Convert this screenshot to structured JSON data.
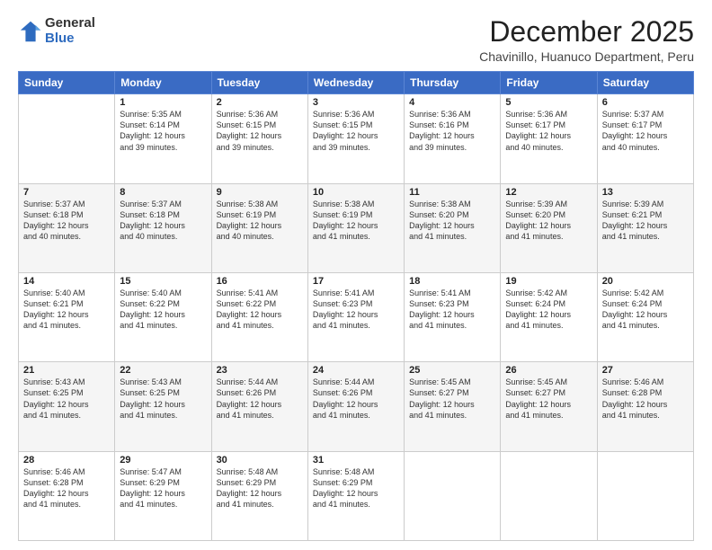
{
  "header": {
    "logo_line1": "General",
    "logo_line2": "Blue",
    "month": "December 2025",
    "location": "Chavinillo, Huanuco Department, Peru"
  },
  "days_of_week": [
    "Sunday",
    "Monday",
    "Tuesday",
    "Wednesday",
    "Thursday",
    "Friday",
    "Saturday"
  ],
  "weeks": [
    [
      {
        "day": "",
        "info": ""
      },
      {
        "day": "1",
        "info": "Sunrise: 5:35 AM\nSunset: 6:14 PM\nDaylight: 12 hours\nand 39 minutes."
      },
      {
        "day": "2",
        "info": "Sunrise: 5:36 AM\nSunset: 6:15 PM\nDaylight: 12 hours\nand 39 minutes."
      },
      {
        "day": "3",
        "info": "Sunrise: 5:36 AM\nSunset: 6:15 PM\nDaylight: 12 hours\nand 39 minutes."
      },
      {
        "day": "4",
        "info": "Sunrise: 5:36 AM\nSunset: 6:16 PM\nDaylight: 12 hours\nand 39 minutes."
      },
      {
        "day": "5",
        "info": "Sunrise: 5:36 AM\nSunset: 6:17 PM\nDaylight: 12 hours\nand 40 minutes."
      },
      {
        "day": "6",
        "info": "Sunrise: 5:37 AM\nSunset: 6:17 PM\nDaylight: 12 hours\nand 40 minutes."
      }
    ],
    [
      {
        "day": "7",
        "info": "Sunrise: 5:37 AM\nSunset: 6:18 PM\nDaylight: 12 hours\nand 40 minutes."
      },
      {
        "day": "8",
        "info": "Sunrise: 5:37 AM\nSunset: 6:18 PM\nDaylight: 12 hours\nand 40 minutes."
      },
      {
        "day": "9",
        "info": "Sunrise: 5:38 AM\nSunset: 6:19 PM\nDaylight: 12 hours\nand 40 minutes."
      },
      {
        "day": "10",
        "info": "Sunrise: 5:38 AM\nSunset: 6:19 PM\nDaylight: 12 hours\nand 41 minutes."
      },
      {
        "day": "11",
        "info": "Sunrise: 5:38 AM\nSunset: 6:20 PM\nDaylight: 12 hours\nand 41 minutes."
      },
      {
        "day": "12",
        "info": "Sunrise: 5:39 AM\nSunset: 6:20 PM\nDaylight: 12 hours\nand 41 minutes."
      },
      {
        "day": "13",
        "info": "Sunrise: 5:39 AM\nSunset: 6:21 PM\nDaylight: 12 hours\nand 41 minutes."
      }
    ],
    [
      {
        "day": "14",
        "info": "Sunrise: 5:40 AM\nSunset: 6:21 PM\nDaylight: 12 hours\nand 41 minutes."
      },
      {
        "day": "15",
        "info": "Sunrise: 5:40 AM\nSunset: 6:22 PM\nDaylight: 12 hours\nand 41 minutes."
      },
      {
        "day": "16",
        "info": "Sunrise: 5:41 AM\nSunset: 6:22 PM\nDaylight: 12 hours\nand 41 minutes."
      },
      {
        "day": "17",
        "info": "Sunrise: 5:41 AM\nSunset: 6:23 PM\nDaylight: 12 hours\nand 41 minutes."
      },
      {
        "day": "18",
        "info": "Sunrise: 5:41 AM\nSunset: 6:23 PM\nDaylight: 12 hours\nand 41 minutes."
      },
      {
        "day": "19",
        "info": "Sunrise: 5:42 AM\nSunset: 6:24 PM\nDaylight: 12 hours\nand 41 minutes."
      },
      {
        "day": "20",
        "info": "Sunrise: 5:42 AM\nSunset: 6:24 PM\nDaylight: 12 hours\nand 41 minutes."
      }
    ],
    [
      {
        "day": "21",
        "info": "Sunrise: 5:43 AM\nSunset: 6:25 PM\nDaylight: 12 hours\nand 41 minutes."
      },
      {
        "day": "22",
        "info": "Sunrise: 5:43 AM\nSunset: 6:25 PM\nDaylight: 12 hours\nand 41 minutes."
      },
      {
        "day": "23",
        "info": "Sunrise: 5:44 AM\nSunset: 6:26 PM\nDaylight: 12 hours\nand 41 minutes."
      },
      {
        "day": "24",
        "info": "Sunrise: 5:44 AM\nSunset: 6:26 PM\nDaylight: 12 hours\nand 41 minutes."
      },
      {
        "day": "25",
        "info": "Sunrise: 5:45 AM\nSunset: 6:27 PM\nDaylight: 12 hours\nand 41 minutes."
      },
      {
        "day": "26",
        "info": "Sunrise: 5:45 AM\nSunset: 6:27 PM\nDaylight: 12 hours\nand 41 minutes."
      },
      {
        "day": "27",
        "info": "Sunrise: 5:46 AM\nSunset: 6:28 PM\nDaylight: 12 hours\nand 41 minutes."
      }
    ],
    [
      {
        "day": "28",
        "info": "Sunrise: 5:46 AM\nSunset: 6:28 PM\nDaylight: 12 hours\nand 41 minutes."
      },
      {
        "day": "29",
        "info": "Sunrise: 5:47 AM\nSunset: 6:29 PM\nDaylight: 12 hours\nand 41 minutes."
      },
      {
        "day": "30",
        "info": "Sunrise: 5:48 AM\nSunset: 6:29 PM\nDaylight: 12 hours\nand 41 minutes."
      },
      {
        "day": "31",
        "info": "Sunrise: 5:48 AM\nSunset: 6:29 PM\nDaylight: 12 hours\nand 41 minutes."
      },
      {
        "day": "",
        "info": ""
      },
      {
        "day": "",
        "info": ""
      },
      {
        "day": "",
        "info": ""
      }
    ]
  ]
}
